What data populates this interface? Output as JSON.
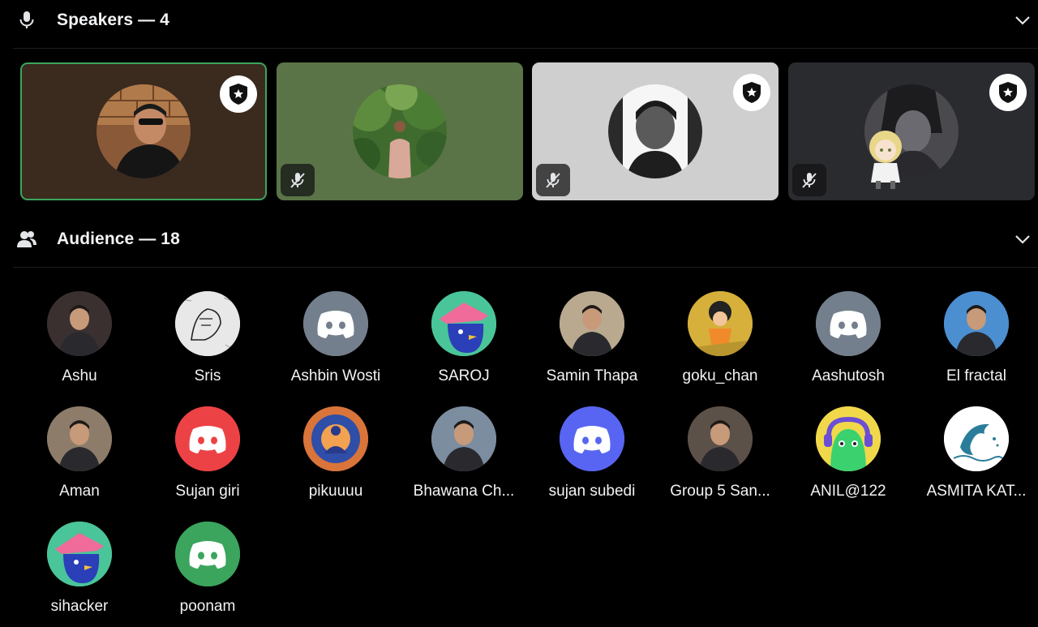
{
  "speakers": {
    "title": "Speakers — 4",
    "icon": "microphone-icon",
    "tiles": [
      {
        "bg": "#3b2a1e",
        "active": true,
        "muted": false,
        "moderator": true
      },
      {
        "bg": "#5a7447",
        "active": false,
        "muted": true,
        "moderator": false
      },
      {
        "bg": "#cfcfcf",
        "active": false,
        "muted": true,
        "moderator": true
      },
      {
        "bg": "#2a2b2f",
        "active": false,
        "muted": true,
        "moderator": true
      }
    ]
  },
  "audience": {
    "title": "Audience — 18",
    "icon": "people-icon",
    "members": [
      {
        "name": "Ashu",
        "avatar": "photo",
        "color": "#3a3030"
      },
      {
        "name": "Sris",
        "avatar": "sketch",
        "color": "#e8e8e8"
      },
      {
        "name": "Ashbin Wosti",
        "avatar": "discord-default",
        "color": "#747f8d"
      },
      {
        "name": "SAROJ",
        "avatar": "bird-cartoon",
        "color": "#4ac59a"
      },
      {
        "name": "Samin Thapa",
        "avatar": "photo",
        "color": "#b9a98f"
      },
      {
        "name": "goku_chan",
        "avatar": "anime",
        "color": "#d6b03a"
      },
      {
        "name": "Aashutosh",
        "avatar": "discord-default",
        "color": "#747f8d"
      },
      {
        "name": "El fractal",
        "avatar": "photo",
        "color": "#4b8fd0"
      },
      {
        "name": "Aman",
        "avatar": "photo",
        "color": "#8d7c6a"
      },
      {
        "name": "Sujan giri",
        "avatar": "discord-default",
        "color": "#ed4245"
      },
      {
        "name": "pikuuuu",
        "avatar": "art",
        "color": "#d9743a"
      },
      {
        "name": "Bhawana Ch...",
        "avatar": "photo",
        "color": "#7c8da0"
      },
      {
        "name": "sujan subedi",
        "avatar": "discord-default",
        "color": "#5865f2"
      },
      {
        "name": "Group 5 San...",
        "avatar": "photo",
        "color": "#5c5148"
      },
      {
        "name": "ANIL@122",
        "avatar": "green-cartoon",
        "color": "#f0d84a"
      },
      {
        "name": "ASMITA KAT...",
        "avatar": "dolphin",
        "color": "#ffffff"
      },
      {
        "name": "sihacker",
        "avatar": "bird-cartoon",
        "color": "#4ac59a"
      },
      {
        "name": "poonam",
        "avatar": "discord-default",
        "color": "#3ba55d"
      }
    ]
  }
}
